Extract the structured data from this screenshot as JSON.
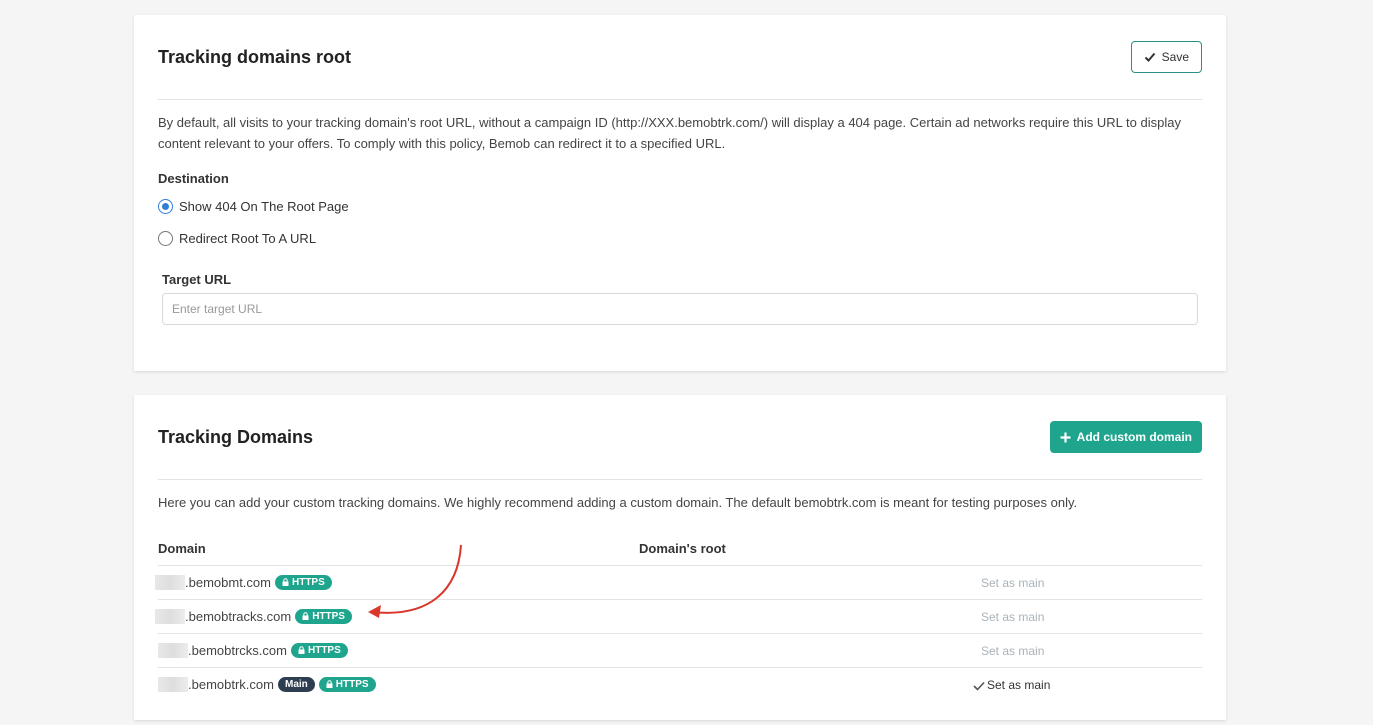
{
  "root_card": {
    "title": "Tracking domains root",
    "save_label": "Save",
    "description": "By default, all visits to your tracking domain's root URL, without a campaign ID (http://XXX.bemobtrk.com/) will display a 404 page. Certain ad networks require this URL to display content relevant to your offers. To comply with this policy, Bemob can redirect it to a specified URL.",
    "destination_label": "Destination",
    "options": [
      {
        "label": "Show 404 On The Root Page",
        "checked": true
      },
      {
        "label": "Redirect Root To A URL",
        "checked": false
      }
    ],
    "target_url_label": "Target URL",
    "target_url_placeholder": "Enter target URL",
    "target_url_value": ""
  },
  "domains_card": {
    "title": "Tracking Domains",
    "add_label": "Add custom domain",
    "description": "Here you can add your custom tracking domains. We highly recommend adding a custom domain. The default bemobtrk.com is meant for testing purposes only.",
    "columns": [
      "Domain",
      "Domain's root",
      ""
    ],
    "rows": [
      {
        "domain": ".bemobmt.com",
        "badges": [
          "HTTPS"
        ],
        "action": "Set as main",
        "is_main": false
      },
      {
        "domain": ".bemobtracks.com",
        "badges": [
          "HTTPS"
        ],
        "action": "Set as main",
        "is_main": false
      },
      {
        "domain": ".bemobtrcks.com",
        "badges": [
          "HTTPS"
        ],
        "action": "Set as main",
        "is_main": false
      },
      {
        "domain": ".bemobtrk.com",
        "badges": [
          "Main",
          "HTTPS"
        ],
        "action": "Set as main",
        "is_main": true
      }
    ]
  },
  "colors": {
    "accent": "#1fa58d",
    "main_badge": "#2c3e50",
    "radio": "#2f7fd6",
    "annotation_arrow": "#d9372b"
  },
  "icons": {
    "save": "check-icon",
    "add": "plus-icon",
    "https": "lock-icon",
    "main_action": "check-icon"
  }
}
